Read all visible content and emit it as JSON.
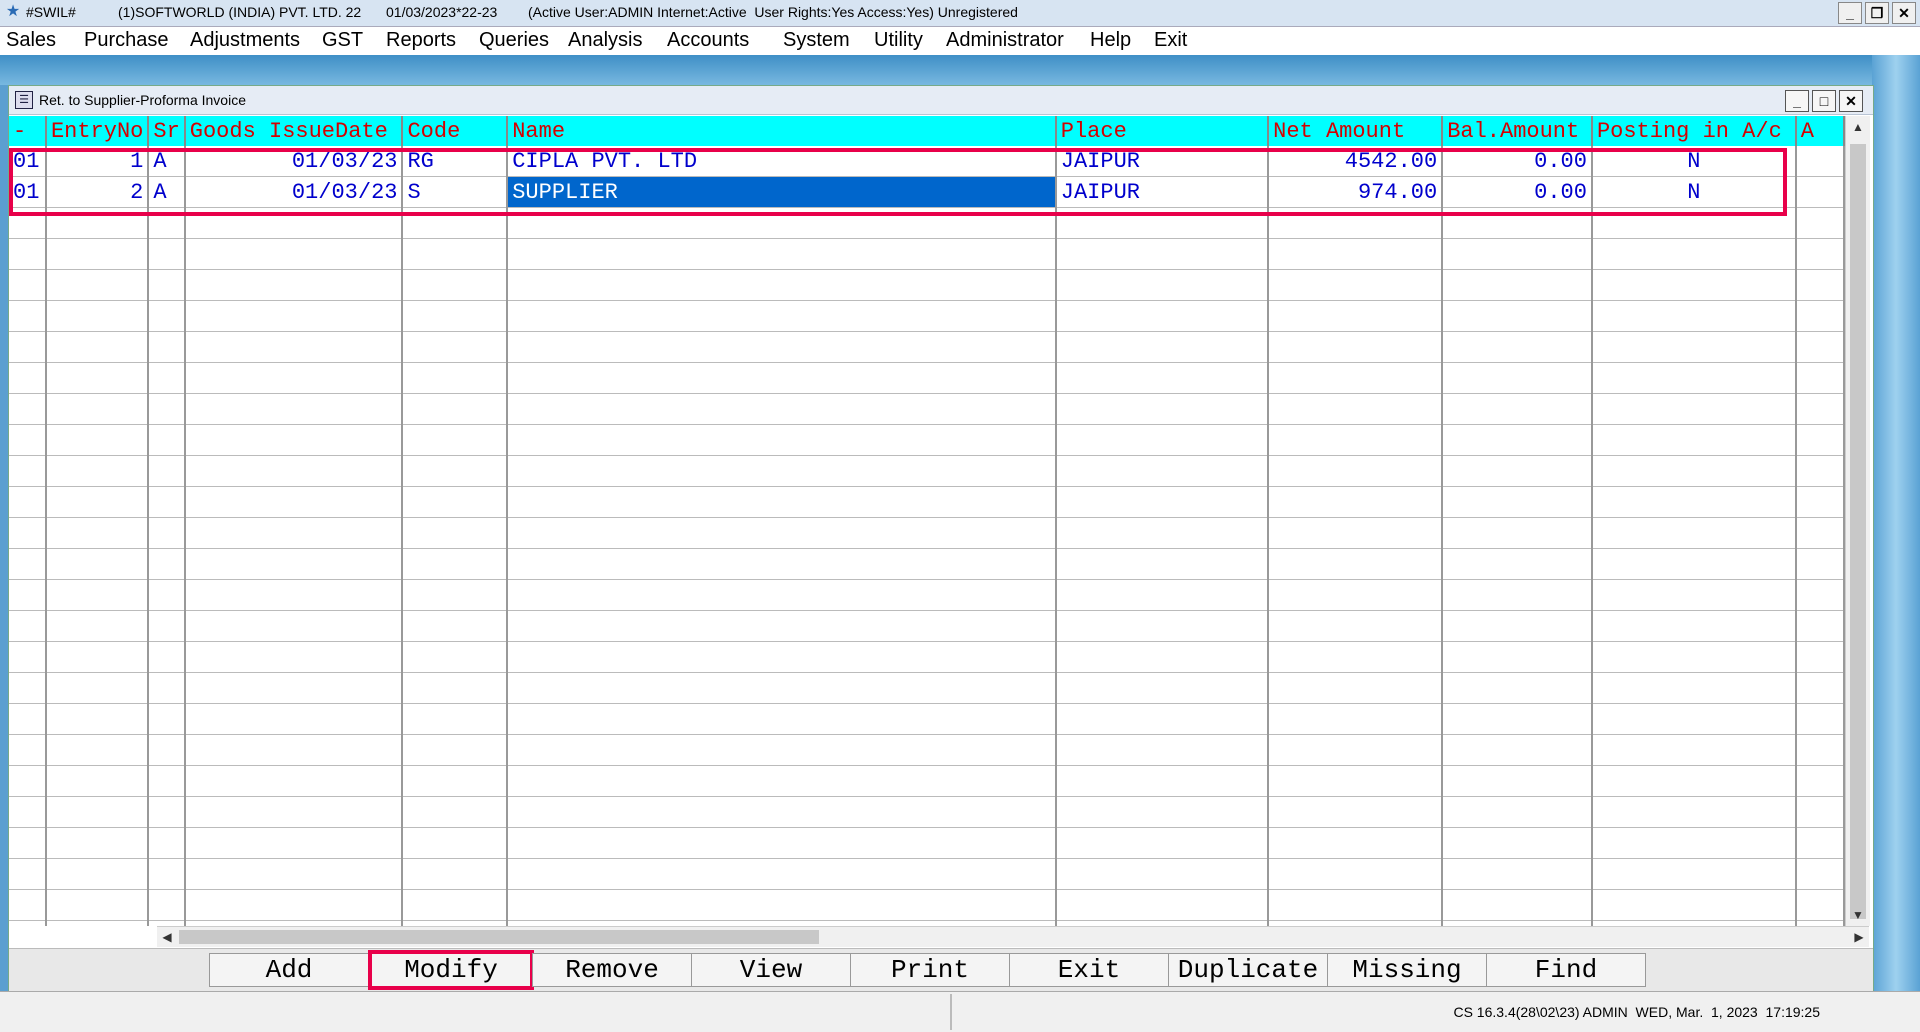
{
  "titlebar": {
    "app": "#SWIL#",
    "company": "(1)SOFTWORLD (INDIA) PVT. LTD. 22",
    "date": "01/03/2023*22-23",
    "status": "(Active User:ADMIN Internet:Active  User Rights:Yes Access:Yes) Unregistered"
  },
  "menu": [
    "Sales",
    "Purchase",
    "Adjustments",
    "GST",
    "Reports",
    "Queries",
    "Analysis",
    "Accounts",
    "System",
    "Utility",
    "Administrator",
    "Help",
    "Exit"
  ],
  "window": {
    "title": "Ret. to Supplier-Proforma Invoice"
  },
  "grid": {
    "headers": [
      "-",
      "EntryNo",
      "Sr",
      "Goods IssueDate",
      "Code",
      "Name",
      "Place",
      "Net Amount",
      "Bal.Amount",
      "Posting in A/c",
      "A"
    ],
    "rows": [
      [
        "01",
        "1",
        "A",
        "01/03/23",
        "RG",
        "CIPLA PVT. LTD",
        "JAIPUR",
        "4542.00",
        "0.00",
        "N",
        ""
      ],
      [
        "01",
        "2",
        "A",
        "01/03/23",
        "S",
        "SUPPLIER",
        "JAIPUR",
        "974.00",
        "0.00",
        "N",
        ""
      ]
    ]
  },
  "buttons": [
    "Add",
    "Modify",
    "Remove",
    "View",
    "Print",
    "Exit",
    "Duplicate",
    "Missing",
    "Find"
  ],
  "statusbar": {
    "text": "CS 16.3.4(28\\02\\23) ADMIN  WED, Mar.  1, 2023  17:19:25"
  },
  "colors": {
    "header_bg": "#00ffff",
    "header_text": "#d40000",
    "cell_text": "#0000cc",
    "selection": "#0066cc",
    "highlight": "#e8004a"
  }
}
